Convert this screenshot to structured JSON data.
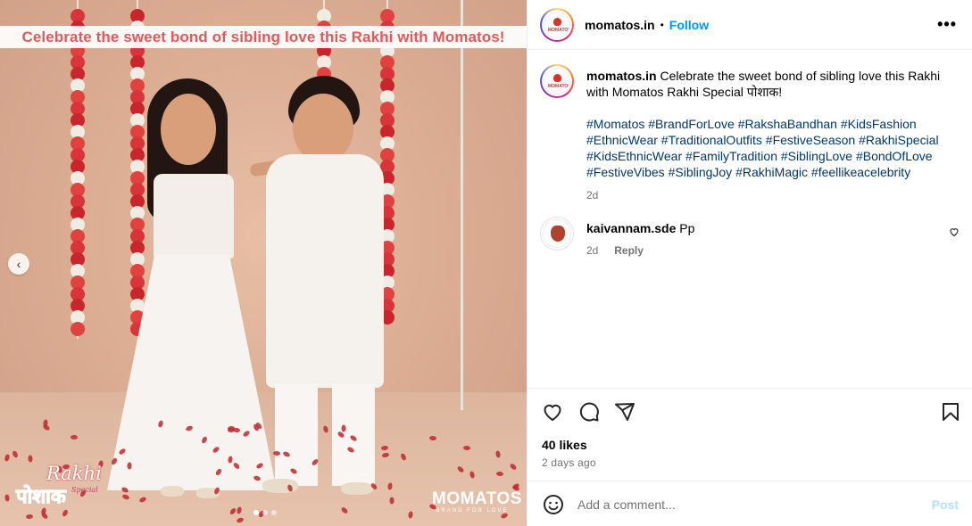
{
  "post": {
    "banner_text": "Celebrate the sweet bond of sibling love this Rakhi with Momatos!",
    "rakhi_logo": {
      "line1": "Rakhi",
      "line2": "पोशाक",
      "line3": "Special"
    },
    "brand_logo": {
      "name": "MOMATOS",
      "tagline": "BRAND FOR LOVE"
    },
    "carousel": {
      "dots": 3,
      "active": 0
    }
  },
  "header": {
    "username": "momatos.in",
    "separator": "•",
    "follow_label": "Follow",
    "more_label": "•••"
  },
  "caption": {
    "username": "momatos.in",
    "text": "Celebrate the sweet bond of sibling love this Rakhi with Momatos Rakhi Special पोशाक!",
    "hashtags": [
      "#Momatos",
      "#BrandForLove",
      "#RakshaBandhan",
      "#KidsFashion",
      "#EthnicWear",
      "#TraditionalOutfits",
      "#FestiveSeason",
      "#RakhiSpecial",
      "#KidsEthnicWear",
      "#FamilyTradition",
      "#SiblingLove",
      "#BondOfLove",
      "#FestiveVibes",
      "#SiblingJoy",
      "#RakhiMagic",
      "#feellikeacelebrity"
    ],
    "time": "2d"
  },
  "comments": [
    {
      "username": "kaivannam.sde",
      "text": "Pp",
      "time": "2d",
      "reply_label": "Reply"
    }
  ],
  "actions": {
    "likes": "40 likes",
    "time_ago": "2 days ago"
  },
  "comment_box": {
    "placeholder": "Add a comment...",
    "post_label": "Post"
  },
  "colors": {
    "accent": "#0095f6",
    "banner_text": "#e05a5a",
    "hashtag": "#00376b",
    "muted": "#737373"
  },
  "icons": [
    "chevron-left-icon",
    "more-icon",
    "heart-icon",
    "comment-icon",
    "share-icon",
    "bookmark-icon",
    "emoji-icon"
  ]
}
